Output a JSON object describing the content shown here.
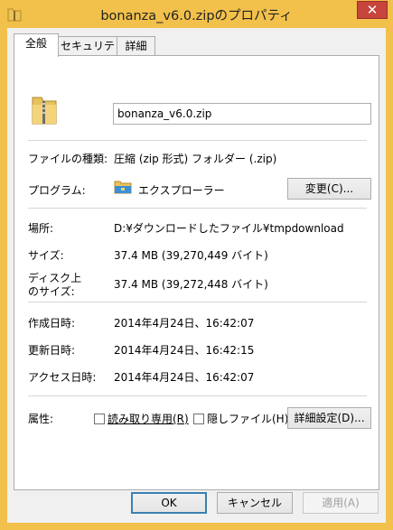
{
  "window": {
    "title": "bonanza_v6.0.zipのプロパティ",
    "close_glyph": "✕"
  },
  "tabs": [
    {
      "label": "全般"
    },
    {
      "label": "セキュリティ"
    },
    {
      "label": "詳細"
    }
  ],
  "general": {
    "file_name": "bonanza_v6.0.zip",
    "file_type_label": "ファイルの種類:",
    "file_type_value": "圧縮 (zip 形式) フォルダー (.zip)",
    "program_label": "プログラム:",
    "program_value": "エクスプローラー",
    "change_button": "変更(C)...",
    "location_label": "場所:",
    "location_value": "D:¥ダウンロードしたファイル¥tmpdownload",
    "size_label": "サイズ:",
    "size_value": "37.4 MB (39,270,449 バイト)",
    "size_on_disk_label_1": "ディスク上",
    "size_on_disk_label_2": "のサイズ:",
    "size_on_disk_value": "37.4 MB (39,272,448 バイト)",
    "created_label": "作成日時:",
    "created_value": "2014年4月24日、16:42:07",
    "modified_label": "更新日時:",
    "modified_value": "2014年4月24日、16:42:15",
    "accessed_label": "アクセス日時:",
    "accessed_value": "2014年4月24日、16:42:07",
    "attributes_label": "属性:",
    "readonly_label": "読み取り専用(R)",
    "hidden_label": "隠しファイル(H)",
    "advanced_button": "詳細設定(D)..."
  },
  "footer": {
    "ok": "OK",
    "cancel": "キャンセル",
    "apply": "適用(A)"
  },
  "colors": {
    "frame": "#f2c14b",
    "close": "#c7453c",
    "ok_border": "#3c7fb1"
  },
  "icons": {
    "title": "zip-folder-icon",
    "file": "zip-folder-icon",
    "program": "file-explorer-icon"
  }
}
